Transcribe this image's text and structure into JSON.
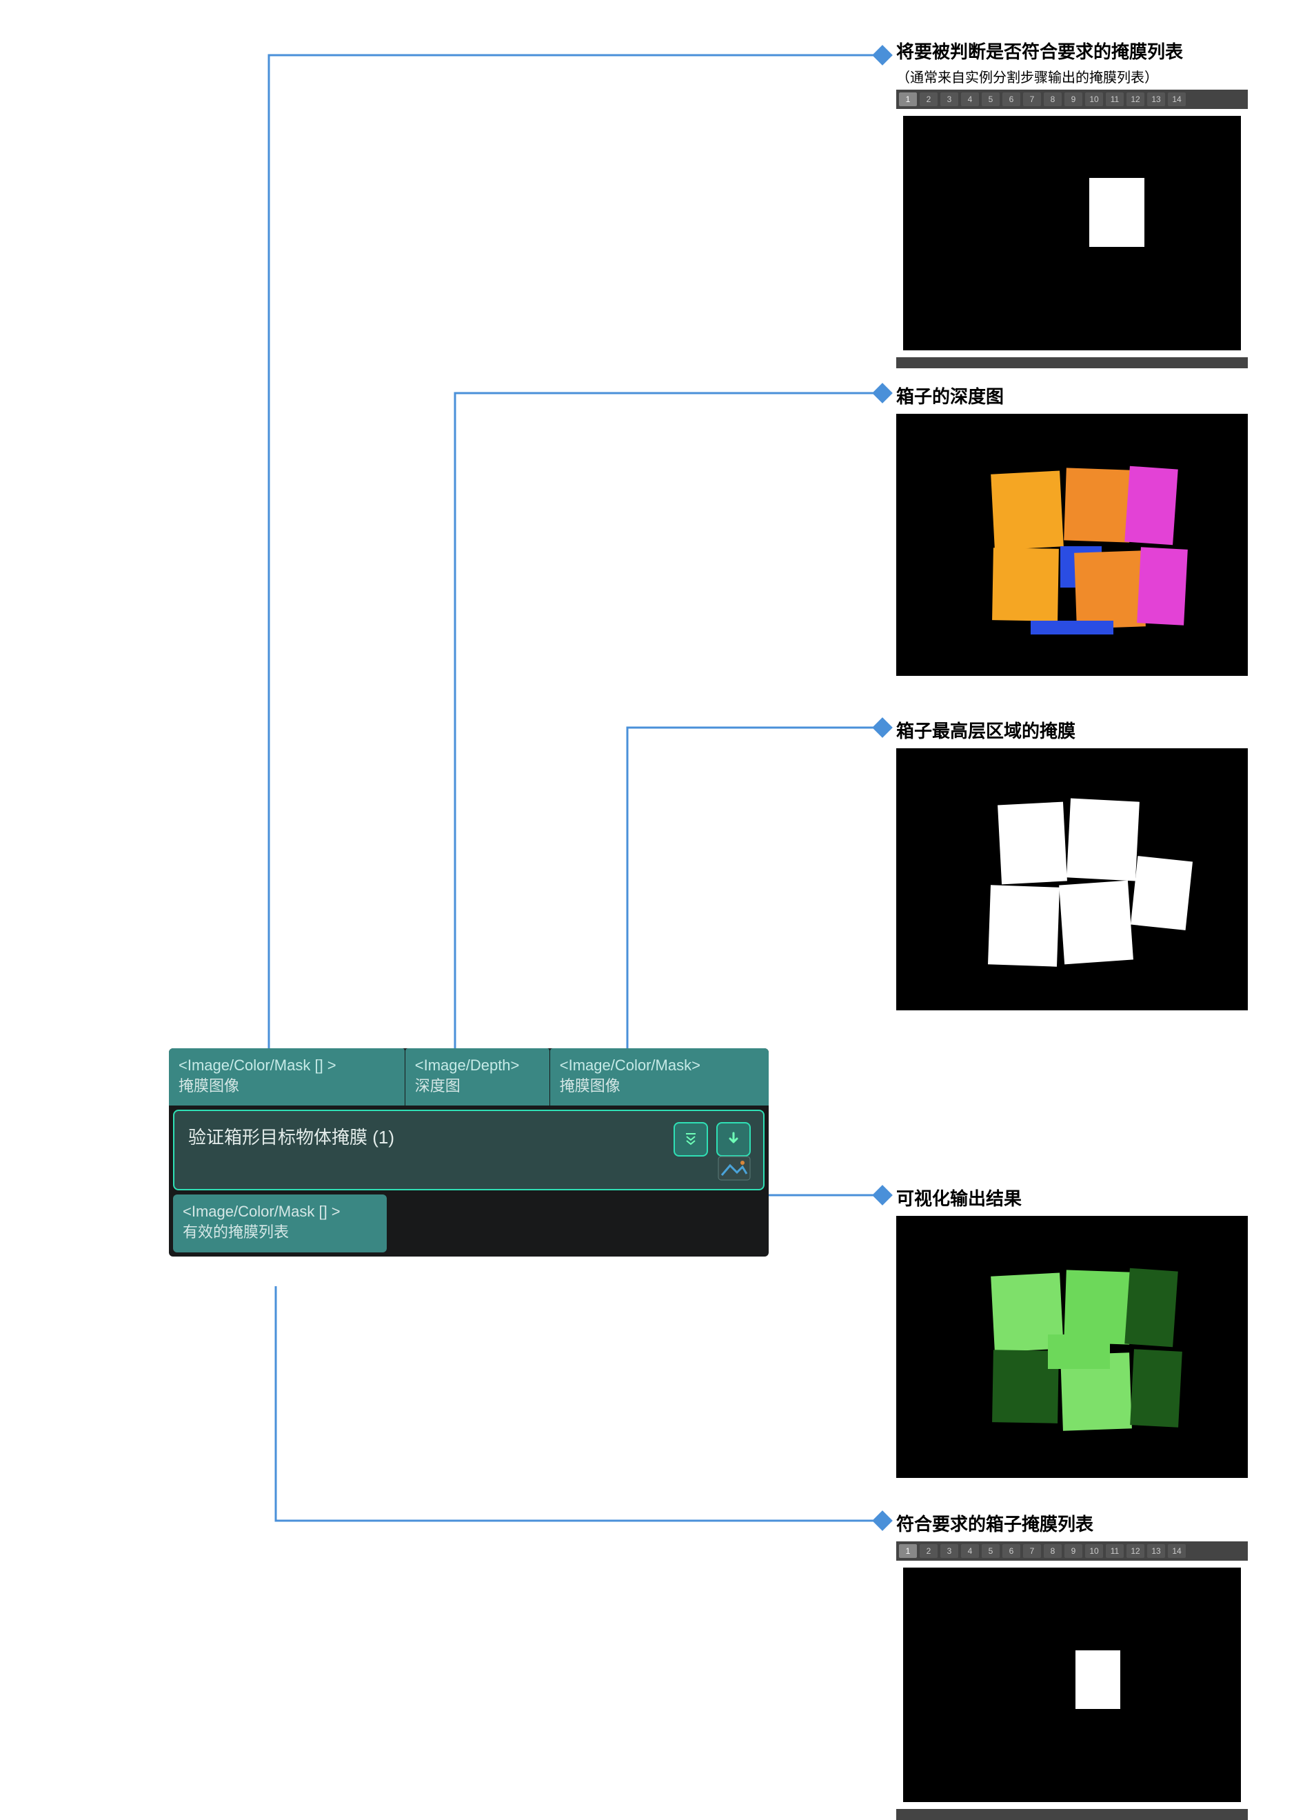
{
  "node": {
    "inputs": [
      {
        "type": "<Image/Color/Mask [] >",
        "label": "掩膜图像"
      },
      {
        "type": "<Image/Depth>",
        "label": "深度图"
      },
      {
        "type": "<Image/Color/Mask>",
        "label": "掩膜图像"
      }
    ],
    "title": "验证箱形目标物体掩膜 (1)",
    "output": {
      "type": "<Image/Color/Mask [] >",
      "label": "有效的掩膜列表"
    },
    "buttons": {
      "expand": "expand",
      "download": "download",
      "image": "image-preview"
    }
  },
  "annotations": {
    "a1": {
      "title": "将要被判断是否符合要求的掩膜列表",
      "sub": "（通常来自实例分割步骤输出的掩膜列表）"
    },
    "a2": {
      "title": "箱子的深度图"
    },
    "a3": {
      "title": "箱子最高层区域的掩膜"
    },
    "a4": {
      "title": "可视化输出结果"
    },
    "a5": {
      "title": "符合要求的箱子掩膜列表"
    }
  },
  "tabs": [
    "1",
    "2",
    "3",
    "4",
    "5",
    "6",
    "7",
    "8",
    "9",
    "10",
    "11",
    "12",
    "13",
    "14"
  ],
  "colors": {
    "connector": "#4a90d9",
    "nodeInputBg": "#3a8783",
    "nodeBodyBg": "#2e4948",
    "nodeBorder": "#2fe0b5"
  }
}
